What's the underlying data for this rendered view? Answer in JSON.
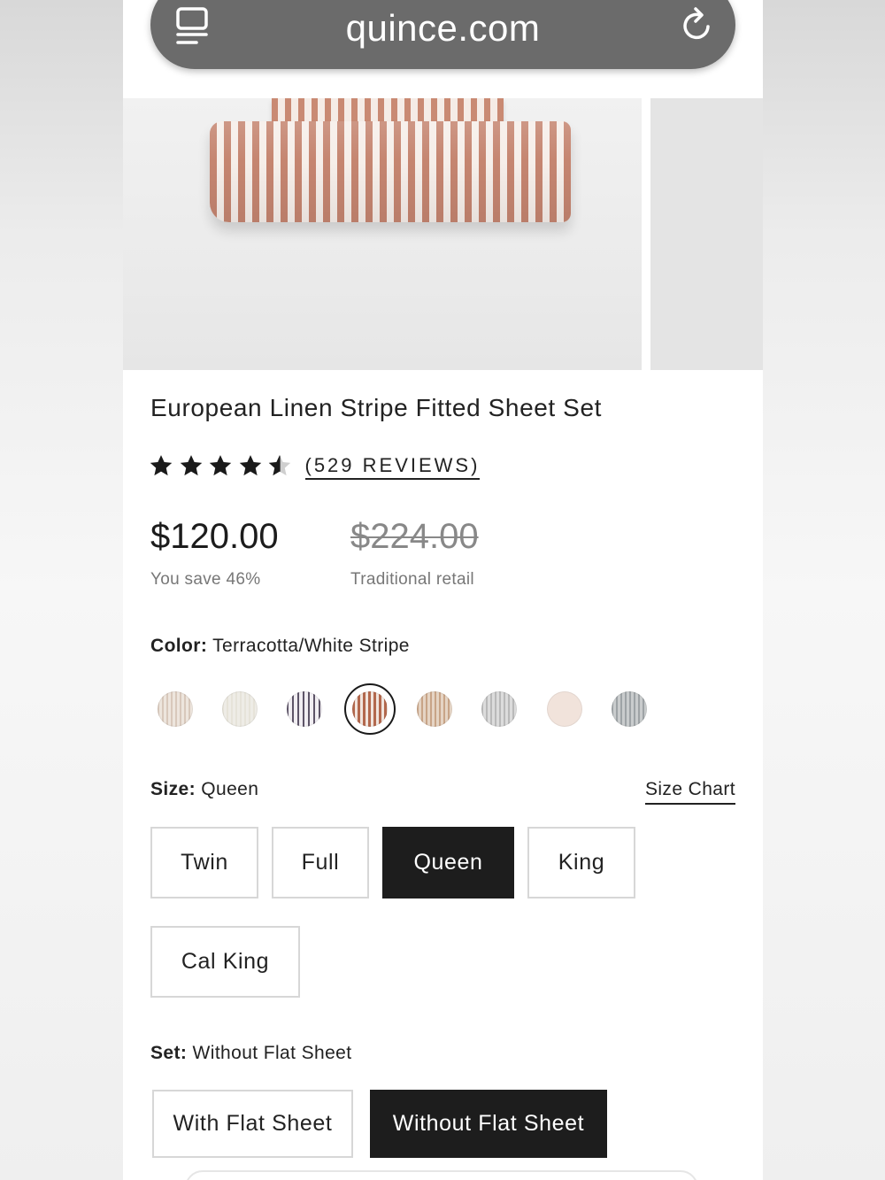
{
  "browser": {
    "url": "quince.com"
  },
  "product": {
    "title": "European Linen Stripe Fitted Sheet Set",
    "rating": 4.6,
    "reviews_label": "(529 REVIEWS)",
    "price": "$120.00",
    "savings": "You save 46%",
    "retail_price": "$224.00",
    "retail_label": "Traditional retail"
  },
  "color": {
    "label": "Color:",
    "value": "Terracotta/White Stripe",
    "selected_index": 3,
    "swatches": [
      {
        "color": "#e6dcd3",
        "pattern": "pinstripe"
      },
      {
        "color": "#eceae2",
        "pattern": "solid"
      },
      {
        "color": "#d9d4de",
        "pattern": "stripe-dark"
      },
      {
        "color": "#c07d63",
        "pattern": "stripe"
      },
      {
        "color": "#d9bea7",
        "pattern": "pinstripe"
      },
      {
        "color": "#cfcfcf",
        "pattern": "pinstripe"
      },
      {
        "color": "#f1e2da",
        "pattern": "solid"
      },
      {
        "color": "#b9bdbf",
        "pattern": "stripe"
      }
    ]
  },
  "size": {
    "label": "Size:",
    "value": "Queen",
    "chart_link": "Size Chart",
    "options": [
      "Twin",
      "Full",
      "Queen",
      "King",
      "Cal King"
    ],
    "selected": "Queen"
  },
  "set": {
    "label": "Set:",
    "value": "Without Flat Sheet",
    "options": [
      "With Flat Sheet",
      "Without Flat Sheet"
    ],
    "selected": "Without Flat Sheet"
  }
}
